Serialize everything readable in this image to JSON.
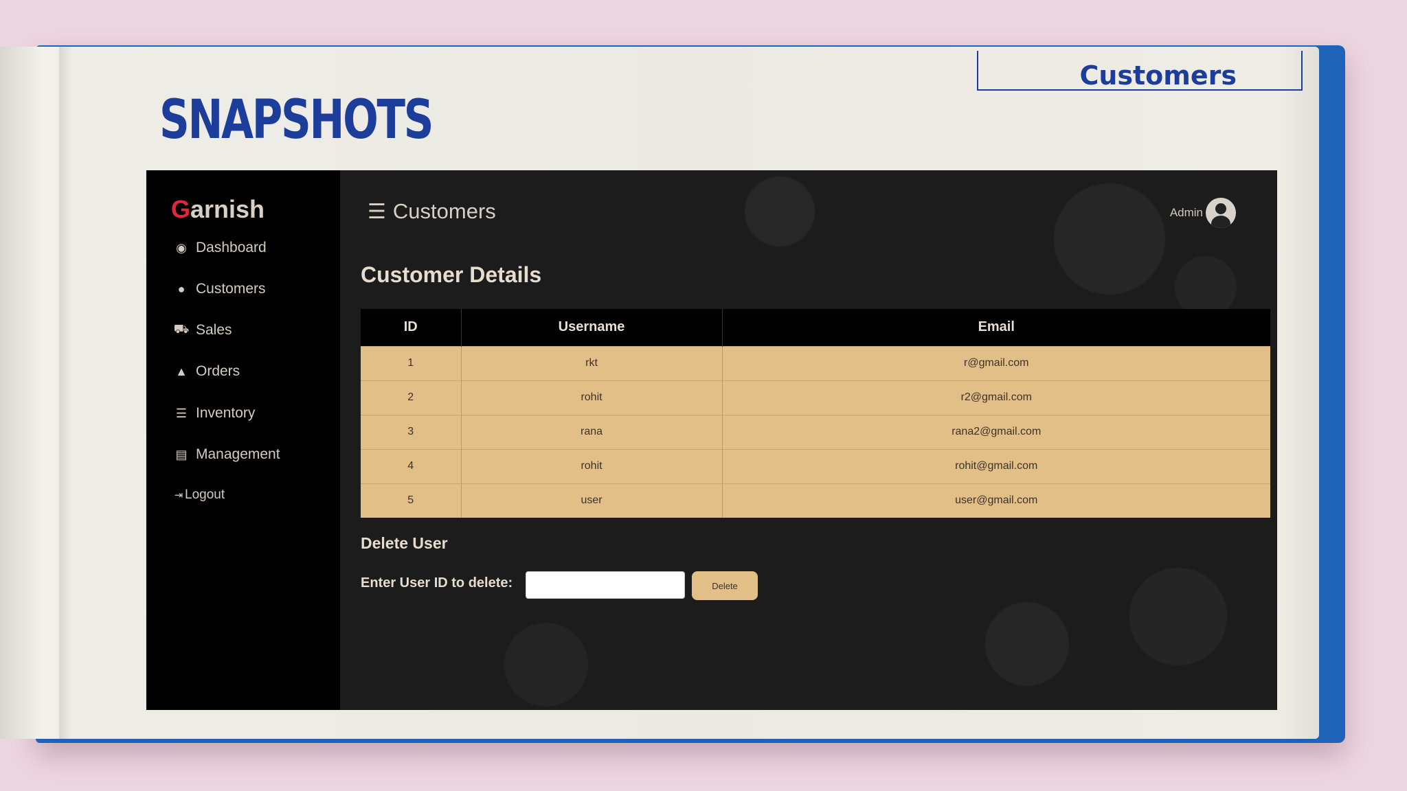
{
  "slide": {
    "title": "SNAPSHOTS",
    "tag": "Customers"
  },
  "app": {
    "brand_first": "G",
    "brand_rest": "arnish",
    "sidebar": {
      "items": [
        {
          "label": "Dashboard",
          "icon": "dashboard-icon"
        },
        {
          "label": "Customers",
          "icon": "users-icon"
        },
        {
          "label": "Sales",
          "icon": "cart-icon"
        },
        {
          "label": "Orders",
          "icon": "bag-icon"
        },
        {
          "label": "Inventory",
          "icon": "list-icon"
        },
        {
          "label": "Management",
          "icon": "card-icon"
        },
        {
          "label": "Logout",
          "icon": "logout-icon"
        }
      ]
    },
    "header": {
      "title": "Customers",
      "user": "Admin"
    },
    "main": {
      "section_title": "Customer Details",
      "table": {
        "columns": [
          "ID",
          "Username",
          "Email"
        ],
        "rows": [
          [
            "1",
            "rkt",
            "r@gmail.com"
          ],
          [
            "2",
            "rohit",
            "r2@gmail.com"
          ],
          [
            "3",
            "rana",
            "rana2@gmail.com"
          ],
          [
            "4",
            "rohit",
            "rohit@gmail.com"
          ],
          [
            "5",
            "user",
            "user@gmail.com"
          ]
        ]
      },
      "delete": {
        "title": "Delete User",
        "label": "Enter User ID to delete:",
        "input_value": "",
        "button_label": "Delete"
      }
    },
    "colors": {
      "accent": "#e3bf88",
      "brand_red": "#e0283c",
      "slide_blue": "#1d3d9a"
    }
  }
}
